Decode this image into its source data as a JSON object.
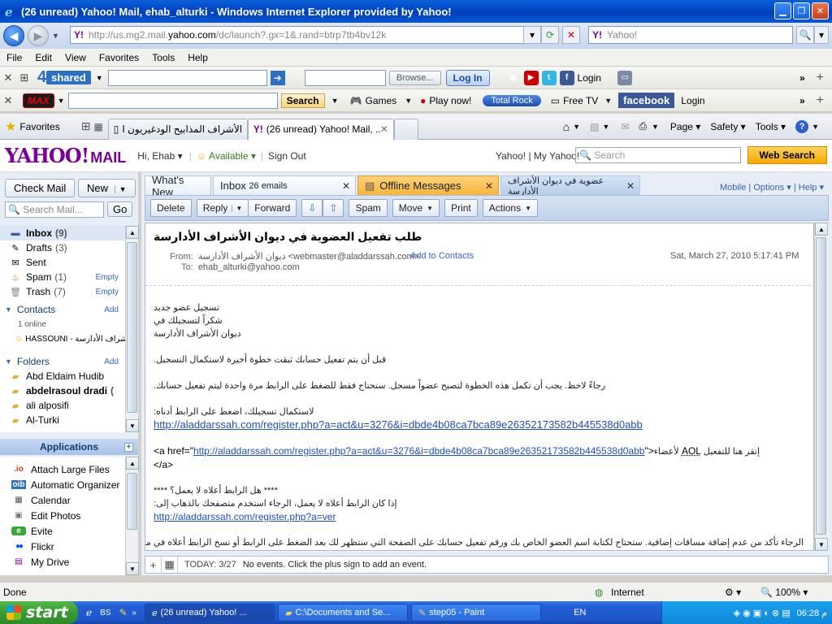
{
  "window": {
    "title": "(26 unread) Yahoo! Mail, ehab_alturki - Windows Internet Explorer provided by Yahoo!"
  },
  "address": {
    "url_prefix": "http://us.mg2.mail.",
    "url_domain": "yahoo.com",
    "url_suffix": "/dc/launch?.gx=1&.rand=btrp7tb4bv12k",
    "search_placeholder": "Yahoo!"
  },
  "menu": [
    "File",
    "Edit",
    "View",
    "Favorites",
    "Tools",
    "Help"
  ],
  "toolbar1": {
    "brand_num": "4",
    "brand": "shared",
    "browse": "Browse...",
    "login": "Log In",
    "login2": "Login"
  },
  "toolbar2": {
    "brand": "MAX",
    "search": "Search",
    "games": "Games",
    "playnow": "Play now!",
    "media": "Total Rock",
    "freetv": "Free TV",
    "facebook": "facebook",
    "login": "Login"
  },
  "tabs": {
    "favorites": "Favorites",
    "tab1": "الأشراف المذابيح الودغيريون ا...",
    "tab2": "(26 unread) Yahoo! Mail, ...",
    "page": "Page",
    "safety": "Safety",
    "tools": "Tools"
  },
  "yahoo": {
    "logo": "YAHOO!",
    "mail": "MAIL",
    "greeting": "Hi, Ehab",
    "available": "Available",
    "signout": "Sign Out",
    "links": "Yahoo! | My Yahoo!",
    "search_placeholder": "Search",
    "websearch": "Web Search"
  },
  "left": {
    "checkmail": "Check Mail",
    "new": "New",
    "search_placeholder": "Search Mail...",
    "go": "Go",
    "folders": [
      {
        "name": "Inbox",
        "count": "(9)"
      },
      {
        "name": "Drafts",
        "count": "(3)"
      },
      {
        "name": "Sent",
        "count": ""
      },
      {
        "name": "Spam",
        "count": "(1)",
        "action": "Empty"
      },
      {
        "name": "Trash",
        "count": "(7)",
        "action": "Empty"
      }
    ],
    "contacts": "Contacts",
    "contacts_add": "Add",
    "online": "1 online",
    "contact1": "HASSOUNI - أشراف الأدارسة",
    "folders_head": "Folders",
    "folders_add": "Add",
    "userfolders": [
      "Abd Eldaim Hudib",
      "abdelrasoul dradi",
      "ali alposifi",
      "Al-Turki"
    ],
    "userfolder_count": "(",
    "apps_head": "Applications",
    "apps": [
      {
        "icon": ".io",
        "name": "Attach Large Files"
      },
      {
        "icon": "oib",
        "name": "Automatic Organizer"
      },
      {
        "icon": "▦",
        "name": "Calendar"
      },
      {
        "icon": "▣",
        "name": "Edit Photos"
      },
      {
        "icon": "e",
        "name": "Evite"
      },
      {
        "icon": "●●",
        "name": "Flickr"
      },
      {
        "icon": "▤",
        "name": "My Drive"
      }
    ]
  },
  "main": {
    "tabs": {
      "whatsnew": "What's New",
      "inbox": "Inbox",
      "inbox_count": "26 emails",
      "offline": "Offline Messages",
      "active": "عضوية في ديوان الأشراف الأدارسة"
    },
    "toplinks": "Mobile | Options ▾ | Help ▾",
    "actions": [
      "Delete",
      "Reply",
      "Forward",
      "Spam",
      "Move",
      "Print",
      "Actions"
    ],
    "subject": "طلب تفعيل العضوية في ديوان الأشراف الأدارسة",
    "from_label": "From:",
    "from": "ديوان الأشراف الأدارسة <webmaster@aladdarssah.com>",
    "addcontacts": "Add to Contacts",
    "to_label": "To:",
    "to": "ehab_alturki@yahoo.com",
    "date": "Sat, March 27, 2010 5:17:41 PM",
    "body": {
      "l1": "تسجيل عضو جديد",
      "l2": "شكراً لتسجيلك في",
      "l3": "ديوان الأشراف الأدارسة",
      "l4": "قبل أن يتم تفعيل حسابك ثبقت خطوة أخيرة لاستكمال التسجيل.",
      "l5": "رجاءً لاحظ. يجب أن تكمل هذه الخطوة لتصبح عضواً مسجل. ستحتاج فقط للضغط على الرابط مرة واحدة ليتم تفعيل حسابك.",
      "l6": "لاستكمال تسجيلك، اضغط على الرابط أدناه:",
      "link1": "http://aladdarssah.com/register.php?a=act&u=3276&i=dbde4b08ca7bca89e26352173582b445538d0abb",
      "a_open": "<a href=\"",
      "a_mid": "\">",
      "a_tail": "لأعضاء",
      "a_aol": "AOL",
      "a_after": "إنقر هنا للتفعيل",
      "a_close": "</a>",
      "l7": "**** هل الرابط أعلاه لا يعمل؟ ****",
      "l8": "إذا كان الرابط أعلاه لا يعمل، الرجاء استخدم متصفحك بالذهاب إلى:",
      "link2": "http://aladdarssah.com/register.php?a=ver",
      "l9": "الرجاء تأكد من عدم إضافة مسافات إضافية. ستحتاج لكتابة اسم العضو الخاص بك ورقم تفعيل حسابك على الصفحة التي ستظهر لك بعد الضغط على الرابط أو نسخ الرابط أعلاه في متصفحك."
    },
    "cal": {
      "today": "TODAY: 3/27",
      "events": "No events. Click the plus sign to add an event."
    }
  },
  "status": {
    "text": "Done",
    "zone": "Internet",
    "zoom": "100%"
  },
  "taskbar": {
    "start": "start",
    "t1": "(26 unread) Yahoo! ...",
    "t2": "C:\\Documents and Se...",
    "t3": "step05 - Paint",
    "lang": "EN",
    "clock": "06:28 م"
  }
}
